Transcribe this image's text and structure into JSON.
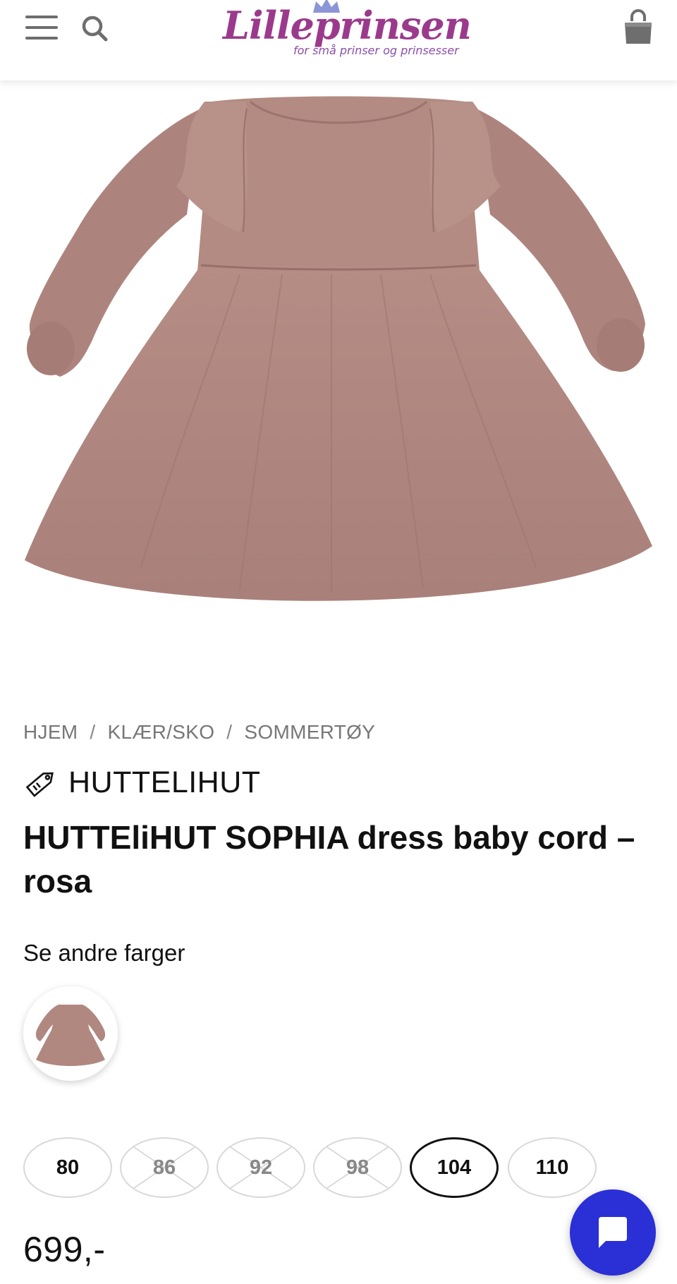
{
  "header": {
    "menu_icon": "hamburger-menu-icon",
    "search_icon": "search-icon",
    "logo_text": "Lilleprinsen",
    "logo_tagline": "for små prinser og prinsesser",
    "cart_icon": "shopping-bag-icon"
  },
  "product_image": {
    "alt": "rosa dress"
  },
  "breadcrumb": [
    "HJEM",
    "KLÆR/SKO",
    "SOMMERTØY"
  ],
  "breadcrumb_separator": "/",
  "brand": {
    "icon": "price-tag-icon",
    "name": "HUTTELIHUT"
  },
  "product": {
    "title": "HUTTEliHUT SOPHIA dress baby cord – rosa",
    "price": "699,-"
  },
  "colors": {
    "label": "Se andre farger"
  },
  "sizes": [
    {
      "label": "80",
      "available": true,
      "selected": false
    },
    {
      "label": "86",
      "available": false,
      "selected": false
    },
    {
      "label": "92",
      "available": false,
      "selected": false
    },
    {
      "label": "98",
      "available": false,
      "selected": false
    },
    {
      "label": "104",
      "available": true,
      "selected": true
    },
    {
      "label": "110",
      "available": true,
      "selected": false
    }
  ],
  "chat": {
    "icon": "chat-bubble-icon",
    "color": "#2a2fd6"
  },
  "theme": {
    "brand_purple": "#9b3a8c",
    "dress_color": "#b08880"
  }
}
